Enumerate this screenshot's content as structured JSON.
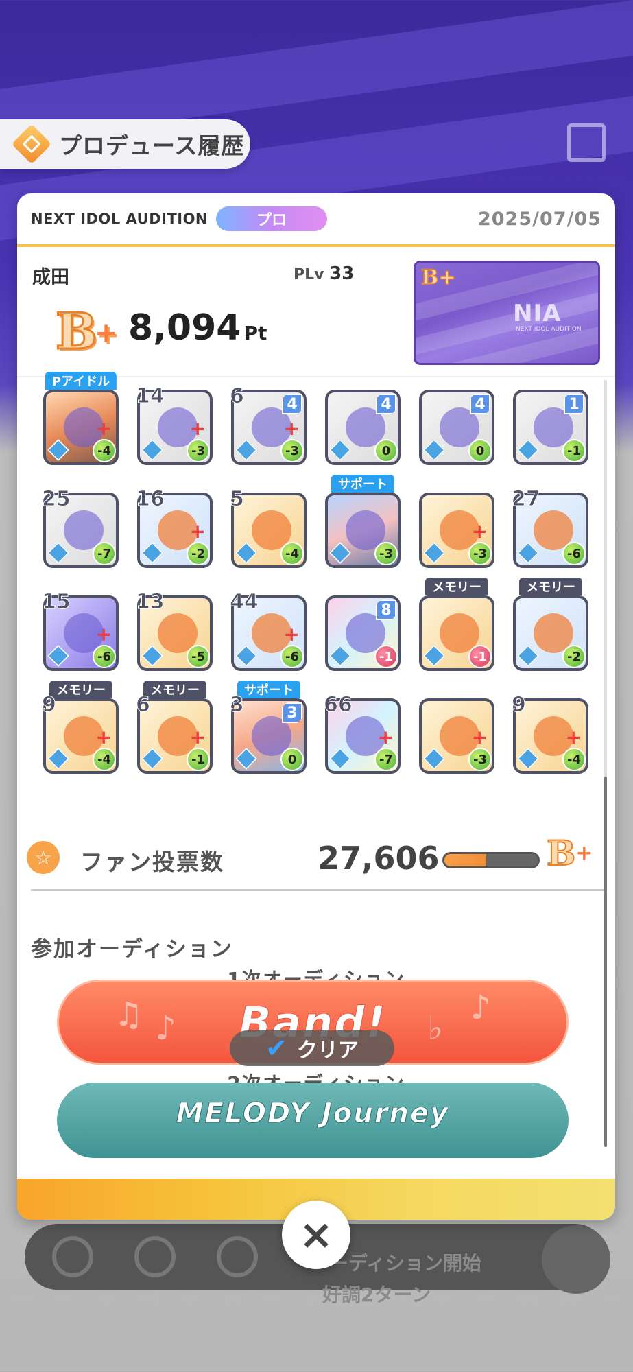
{
  "header": {
    "title": "プロデュース履歴",
    "icon": "history-diamond-icon"
  },
  "modal": {
    "audition_name": "NEXT IDOL AUDITION",
    "rank_label": "プロ",
    "date": "2025/07/05",
    "player_name": "成田",
    "plv_label": "PLv",
    "plv_value": "33",
    "grade": "B",
    "grade_plus": "+",
    "score": "8,094",
    "score_unit": "Pt",
    "card_logo": "NIA",
    "card_logo_sub": "NEXT IDOL AUDITION",
    "card_grade": "B+"
  },
  "cards": [
    {
      "num": "",
      "badge": "",
      "cost": "-4",
      "tag": "Pアイドル",
      "tagType": "blue",
      "bg": "photo",
      "plus": true
    },
    {
      "num": "14",
      "badge": "",
      "cost": "-3",
      "tag": "",
      "bg": "silver",
      "plus": true
    },
    {
      "num": "6",
      "badge": "4",
      "cost": "-3",
      "tag": "",
      "bg": "silver",
      "plus": true
    },
    {
      "num": "",
      "badge": "4",
      "cost": "0",
      "tag": "",
      "bg": "silver",
      "plus": false
    },
    {
      "num": "",
      "badge": "4",
      "cost": "0",
      "tag": "",
      "bg": "silver",
      "plus": false
    },
    {
      "num": "",
      "badge": "1",
      "cost": "-1",
      "tag": "",
      "bg": "silver",
      "plus": false
    },
    {
      "num": "25",
      "badge": "",
      "cost": "-7",
      "tag": "",
      "bg": "silver",
      "plus": false
    },
    {
      "num": "16",
      "badge": "",
      "cost": "-2",
      "tag": "",
      "bg": "blue",
      "plus": true
    },
    {
      "num": "5",
      "badge": "",
      "cost": "-4",
      "tag": "",
      "bg": "gold",
      "plus": false
    },
    {
      "num": "",
      "badge": "",
      "cost": "-3",
      "tag": "サポート",
      "tagType": "blue",
      "bg": "photo2",
      "plus": false
    },
    {
      "num": "",
      "badge": "",
      "cost": "-3",
      "tag": "",
      "bg": "gold",
      "plus": true
    },
    {
      "num": "27",
      "badge": "",
      "cost": "-6",
      "tag": "",
      "bg": "blue",
      "plus": false
    },
    {
      "num": "15",
      "badge": "",
      "cost": "-6",
      "tag": "",
      "bg": "purple",
      "plus": true
    },
    {
      "num": "13",
      "badge": "",
      "cost": "-5",
      "tag": "",
      "bg": "gold",
      "plus": false
    },
    {
      "num": "44",
      "badge": "",
      "cost": "-6",
      "tag": "",
      "bg": "blue",
      "plus": true
    },
    {
      "num": "",
      "badge": "8",
      "cost": "-1",
      "costRed": true,
      "tag": "",
      "bg": "rainbow",
      "plus": false
    },
    {
      "num": "",
      "badge": "",
      "cost": "-1",
      "costRed": true,
      "tag": "メモリー",
      "tagType": "dark",
      "bg": "gold",
      "plus": false
    },
    {
      "num": "",
      "badge": "",
      "cost": "-2",
      "tag": "メモリー",
      "tagType": "dark",
      "bg": "blue",
      "plus": false
    },
    {
      "num": "9",
      "badge": "",
      "cost": "-4",
      "tag": "メモリー",
      "tagType": "dark",
      "bg": "gold",
      "plus": true
    },
    {
      "num": "6",
      "badge": "",
      "cost": "-1",
      "tag": "メモリー",
      "tagType": "dark",
      "bg": "gold",
      "plus": true
    },
    {
      "num": "3",
      "badge": "3",
      "cost": "0",
      "tag": "サポート",
      "tagType": "blue",
      "bg": "photo3",
      "plus": false
    },
    {
      "num": "66",
      "badge": "",
      "cost": "-7",
      "tag": "",
      "bg": "rainbow",
      "plus": true
    },
    {
      "num": "",
      "badge": "",
      "cost": "-3",
      "tag": "",
      "bg": "gold",
      "plus": true
    },
    {
      "num": "9",
      "badge": "",
      "cost": "-4",
      "tag": "",
      "bg": "gold",
      "plus": true
    }
  ],
  "fan": {
    "label": "ファン投票数",
    "value": "27,606",
    "grade": "B",
    "grade_plus": "+",
    "progress": 0.45
  },
  "auditions": {
    "title": "参加オーディション",
    "round1": "1次オーディション",
    "round1_banner": "Band!",
    "round1_status": "クリア",
    "round2": "2次オーディション",
    "round2_banner": "MELODY Journey"
  },
  "background": {
    "text1": "ーディション開始",
    "text2": "好調2ターン"
  },
  "close_label": "×"
}
